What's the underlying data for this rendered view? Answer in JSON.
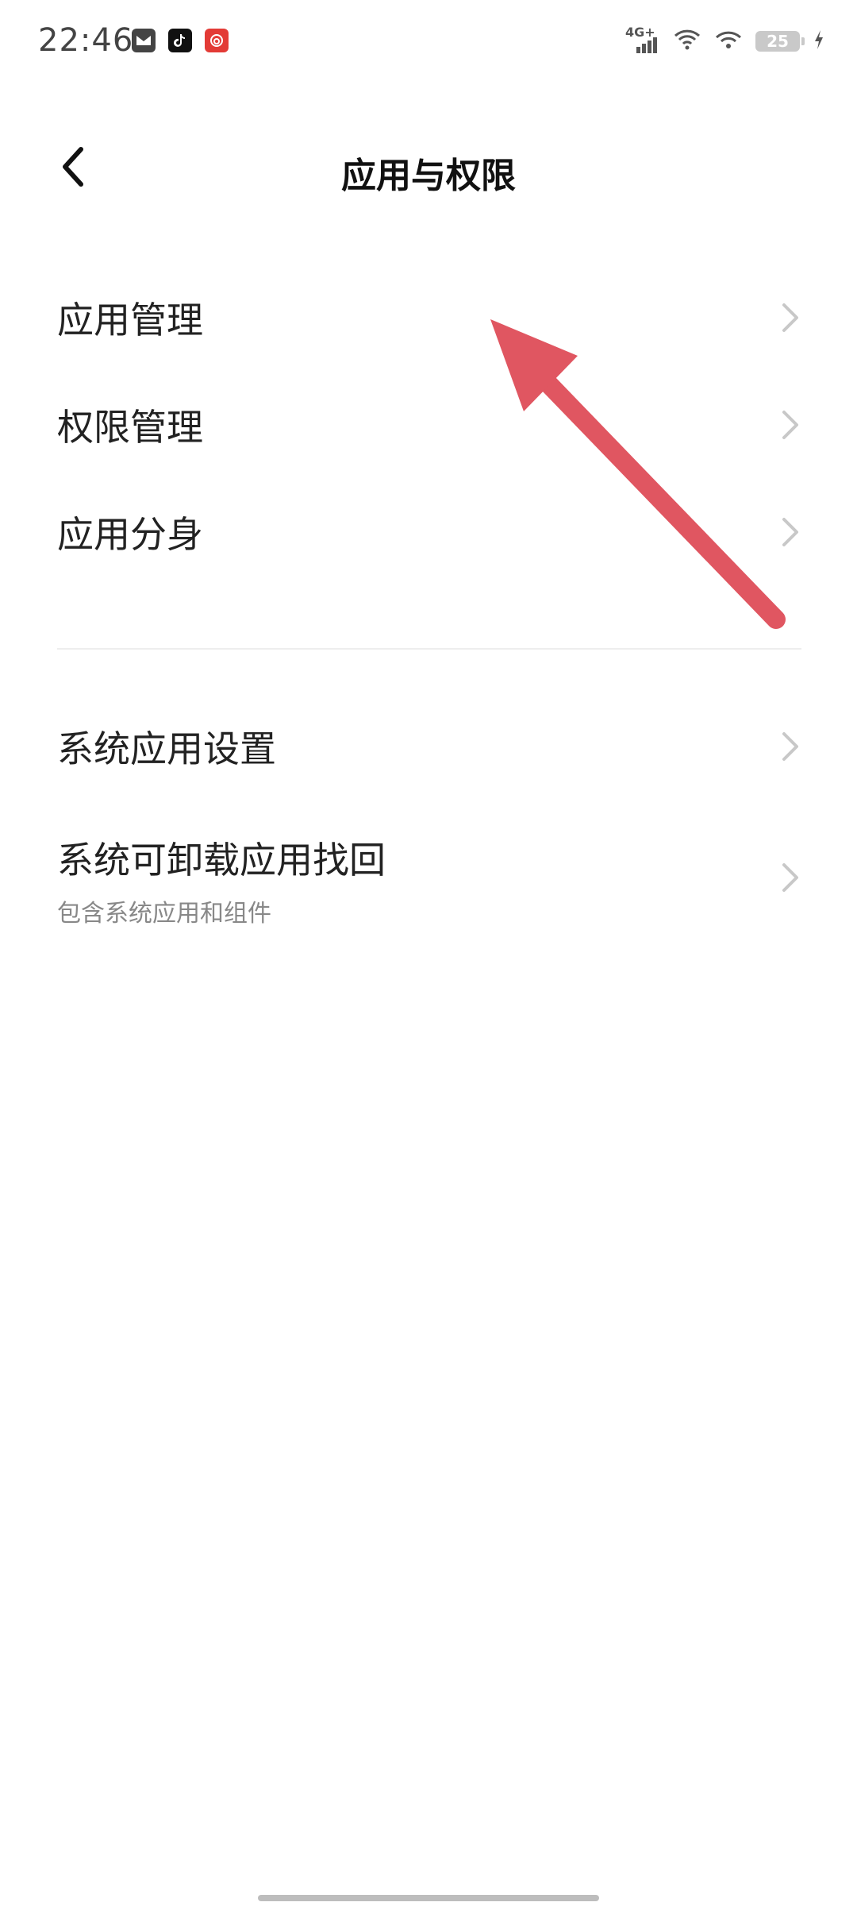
{
  "status_bar": {
    "time": "22:46",
    "network": "4G+",
    "battery": "25",
    "icons": [
      "notification-app-icon",
      "tiktok-icon",
      "netease-music-icon",
      "signal-icon",
      "wifi-icon",
      "hotspot-icon",
      "battery-icon",
      "charging-icon"
    ]
  },
  "header": {
    "title": "应用与权限",
    "back_icon": "chevron-left-icon"
  },
  "items": [
    {
      "label": "应用管理"
    },
    {
      "label": "权限管理"
    },
    {
      "label": "应用分身"
    },
    {
      "label": "系统应用设置"
    },
    {
      "label": "系统可卸载应用找回",
      "sub": "包含系统应用和组件"
    }
  ],
  "annotation": {
    "arrow_color": "#e05661"
  }
}
